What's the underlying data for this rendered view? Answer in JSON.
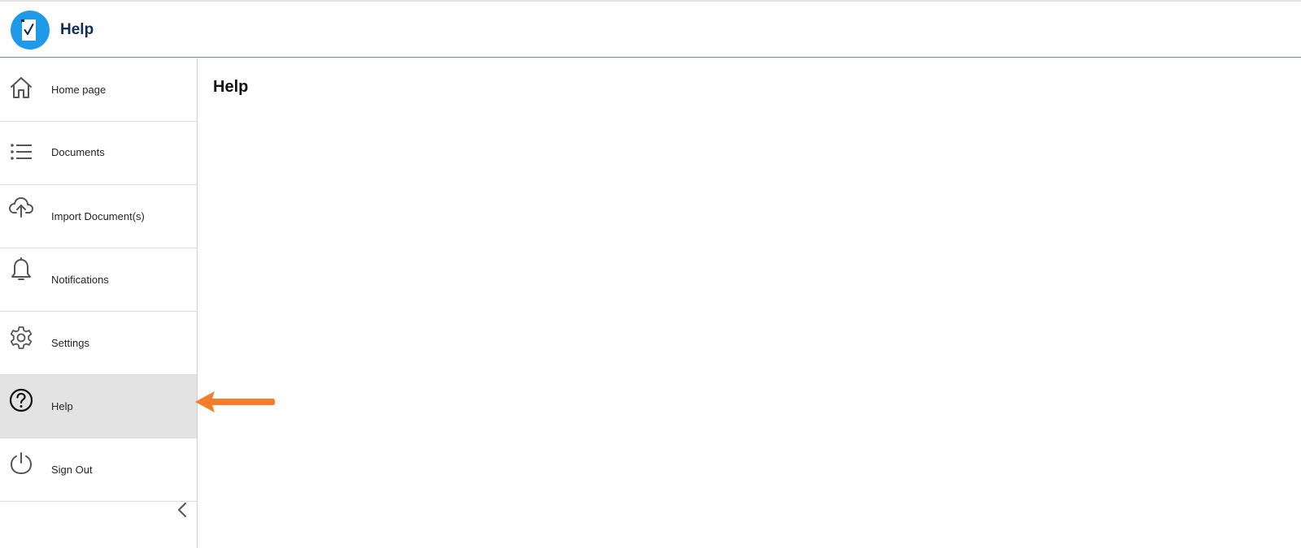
{
  "header": {
    "app_title": "Help",
    "logo_icon": "document-check-icon",
    "logo_color": "#1e9ae8"
  },
  "sidebar": {
    "items": [
      {
        "label": "Home page",
        "icon": "home-icon",
        "active": false
      },
      {
        "label": "Documents",
        "icon": "list-icon",
        "active": false
      },
      {
        "label": "Import Document(s)",
        "icon": "cloud-upload-icon",
        "active": false
      },
      {
        "label": "Notifications",
        "icon": "bell-icon",
        "active": false
      },
      {
        "label": "Settings",
        "icon": "gear-icon",
        "active": false
      },
      {
        "label": "Help",
        "icon": "help-circle-icon",
        "active": true
      },
      {
        "label": "Sign Out",
        "icon": "power-icon",
        "active": false
      }
    ],
    "collapse_icon": "chevron-left-icon"
  },
  "main": {
    "title": "Help"
  },
  "annotation": {
    "icon": "arrow-left-icon",
    "color": "#f57c2b"
  }
}
